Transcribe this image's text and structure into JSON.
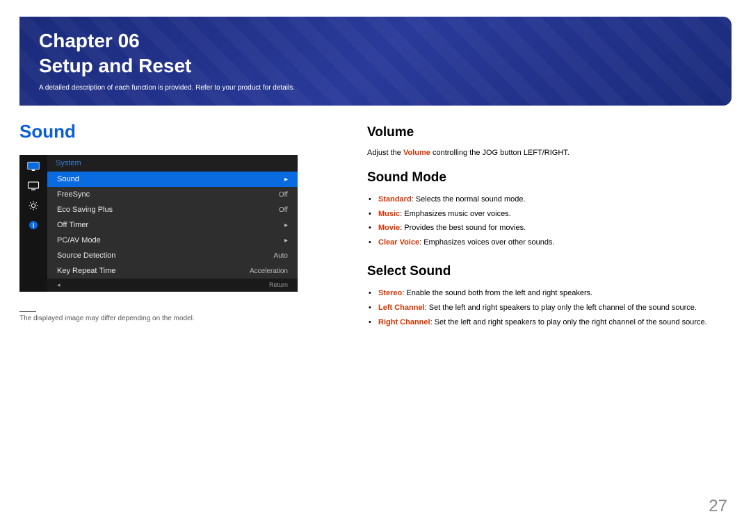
{
  "banner": {
    "chapter": "Chapter 06",
    "title": "Setup and Reset",
    "subtitle": "A detailed description of each function is provided. Refer to your product for details."
  },
  "left": {
    "heading": "Sound",
    "osd": {
      "header": "System",
      "rows": [
        {
          "label": "Sound",
          "value": "▸",
          "selected": true
        },
        {
          "label": "FreeSync",
          "value": "Off",
          "selected": false
        },
        {
          "label": "Eco Saving Plus",
          "value": "Off",
          "selected": false
        },
        {
          "label": "Off Timer",
          "value": "▸",
          "selected": false
        },
        {
          "label": "PC/AV Mode",
          "value": "▸",
          "selected": false
        },
        {
          "label": "Source Detection",
          "value": "Auto",
          "selected": false
        },
        {
          "label": "Key Repeat Time",
          "value": "Acceleration",
          "selected": false
        }
      ],
      "foot_left": "◂",
      "foot_right": "Return"
    },
    "footnote": "The displayed image may differ depending on the model."
  },
  "right": {
    "volume": {
      "heading": "Volume",
      "desc_pre": "Adjust the ",
      "desc_term": "Volume",
      "desc_post": " controlling the JOG button LEFT/RIGHT."
    },
    "sound_mode": {
      "heading": "Sound Mode",
      "items": [
        {
          "term": "Standard",
          "desc": ": Selects the normal sound mode."
        },
        {
          "term": "Music",
          "desc": ": Emphasizes music over voices."
        },
        {
          "term": "Movie",
          "desc": ": Provides the best sound for movies."
        },
        {
          "term": "Clear Voice",
          "desc": ": Emphasizes voices over other sounds."
        }
      ]
    },
    "select_sound": {
      "heading": "Select Sound",
      "items": [
        {
          "term": "Stereo",
          "desc": ": Enable the sound both from the left and right speakers."
        },
        {
          "term": "Left Channel",
          "desc": ": Set the left and right speakers to play only the left channel of the sound source."
        },
        {
          "term": "Right Channel",
          "desc": ": Set the left and right speakers to play only the right channel of the sound source."
        }
      ]
    }
  },
  "page_number": "27"
}
